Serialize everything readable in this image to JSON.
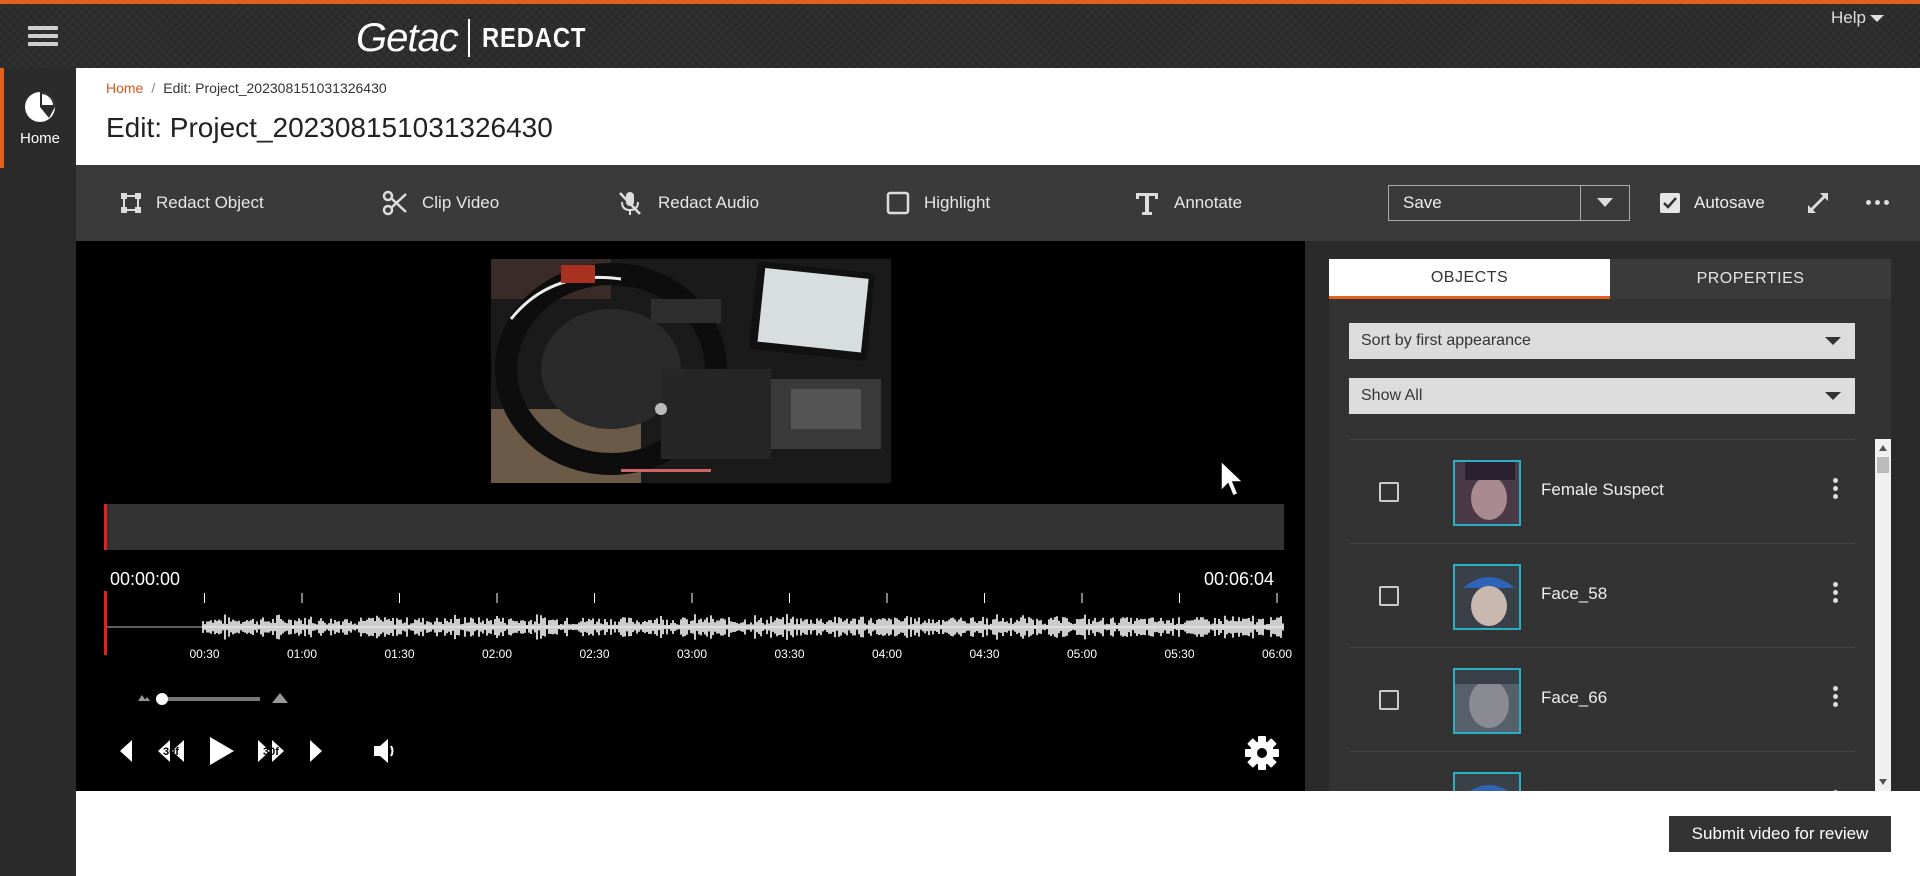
{
  "topbar": {
    "brand": "Getac",
    "product": "REDACT",
    "help_label": "Help"
  },
  "nav": {
    "home_label": "Home"
  },
  "header": {
    "breadcrumb_home": "Home",
    "breadcrumb_current": "Edit: Project_202308151031326430",
    "title": "Edit: Project_202308151031326430"
  },
  "toolbar": {
    "redact_object": "Redact Object",
    "clip_video": "Clip Video",
    "redact_audio": "Redact Audio",
    "highlight": "Highlight",
    "annotate": "Annotate",
    "save_label": "Save",
    "autosave_label": "Autosave"
  },
  "player": {
    "time_start": "00:00:00",
    "time_end": "00:06:04",
    "ticks": [
      "00:30",
      "01:00",
      "01:30",
      "02:00",
      "02:30",
      "03:00",
      "03:30",
      "04:00",
      "04:30",
      "05:00",
      "05:30",
      "06:00"
    ],
    "skip_back_label": "30f",
    "skip_forward_label": "30f"
  },
  "panel": {
    "tab_objects": "OBJECTS",
    "tab_properties": "PROPERTIES",
    "sort_value": "Sort by first appearance",
    "filter_value": "Show All",
    "objects": [
      {
        "name": "Female Suspect"
      },
      {
        "name": "Face_58"
      },
      {
        "name": "Face_66"
      },
      {
        "name": ""
      }
    ]
  },
  "footer": {
    "submit_label": "Submit video for review"
  }
}
